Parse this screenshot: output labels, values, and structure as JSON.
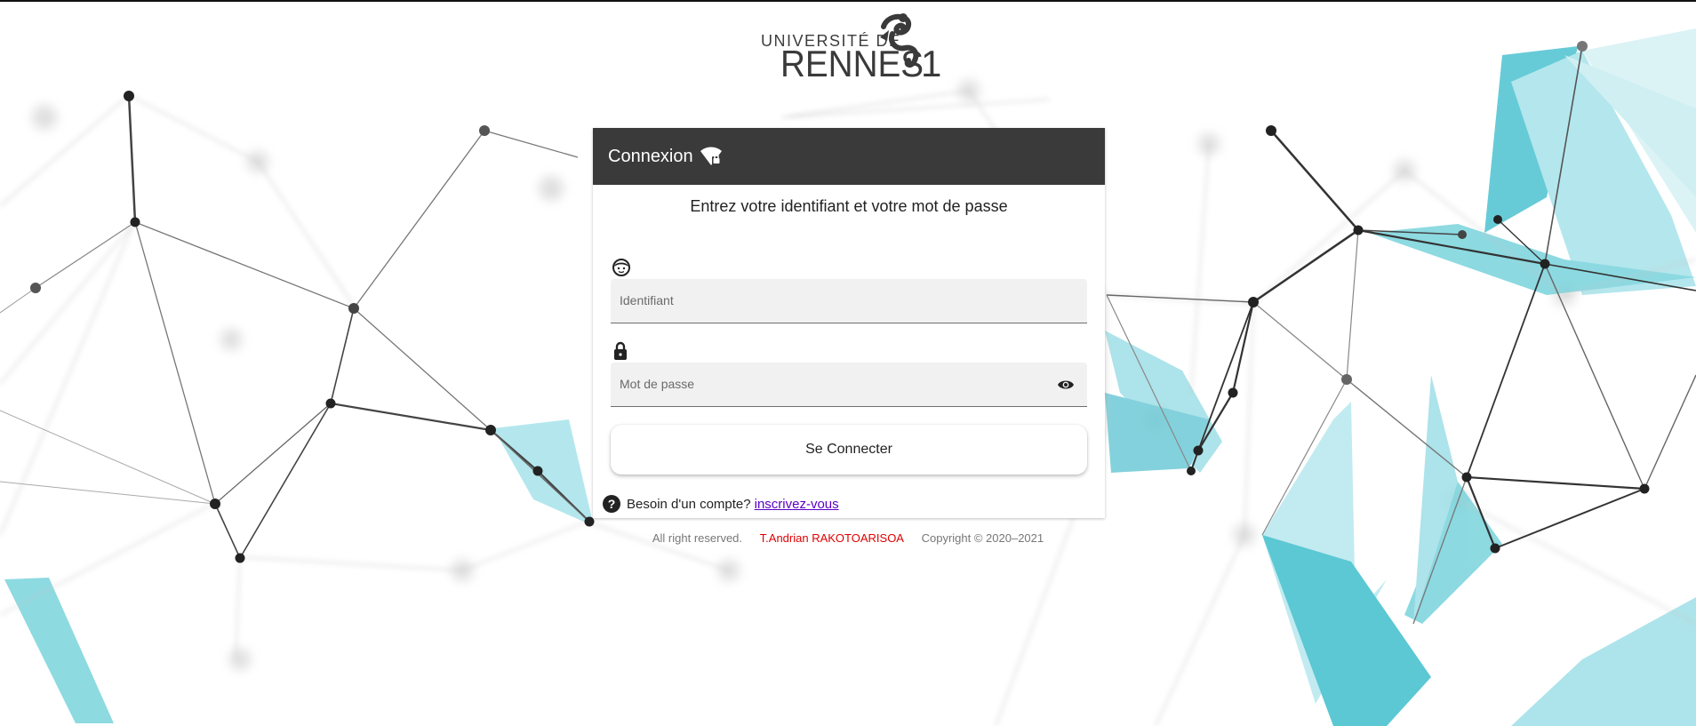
{
  "logo": {
    "line1": "UNIVERSITÉ DE",
    "line2": "RENNES",
    "number": "1"
  },
  "card": {
    "header": "Connexion",
    "subtitle": "Entrez votre identifiant et votre mot de passe",
    "username": {
      "placeholder": "Identifiant",
      "value": ""
    },
    "password": {
      "placeholder": "Mot de passe",
      "value": ""
    },
    "submit_label": "Se Connecter",
    "signup_prompt": "Besoin d'un compte?",
    "signup_link": "inscrivez-vous"
  },
  "footer": {
    "rights": "All right reserved.",
    "author": "T.Andrian RAKOTOARISOA",
    "copyright": "Copyright © 2020–2021"
  },
  "colors": {
    "header_bg": "#3a3a3a",
    "accent_teal": "#2fc0cf",
    "link": "#5a00c8",
    "author": "#e00000"
  },
  "icons": [
    "wifi-lock-icon",
    "user-face-icon",
    "lock-icon",
    "eye-icon",
    "help-icon"
  ]
}
